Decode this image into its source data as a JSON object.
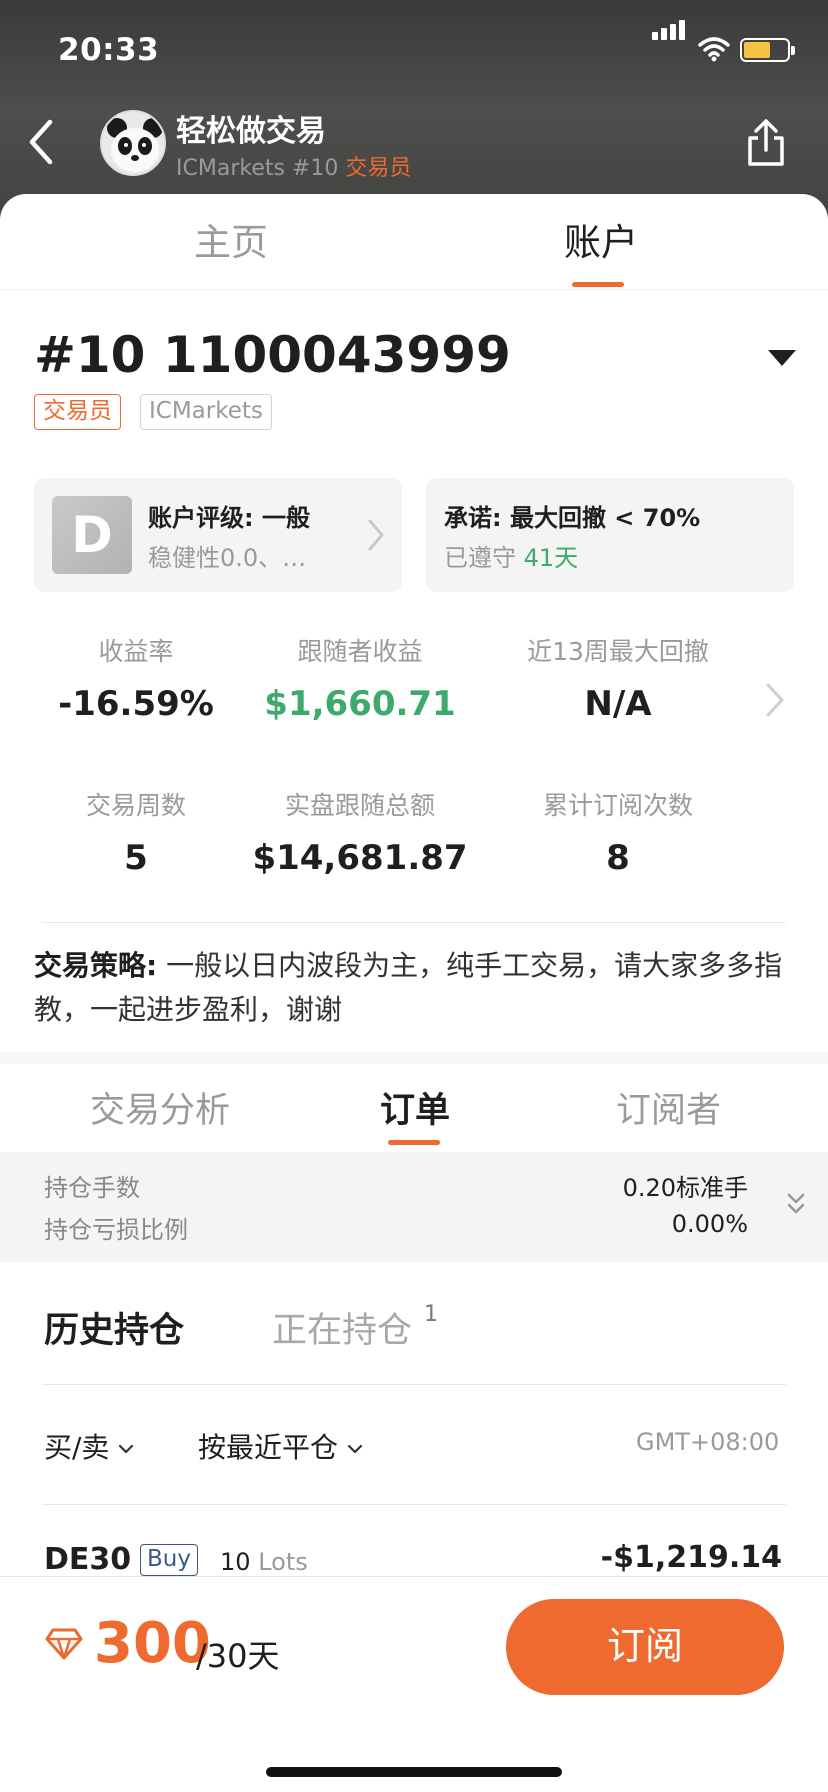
{
  "status_bar": {
    "time": "20:33"
  },
  "header": {
    "title": "轻松做交易",
    "broker_line": "ICMarkets #10",
    "role_tag": "交易员"
  },
  "top_tabs": [
    {
      "label": "主页",
      "active": false
    },
    {
      "label": "账户",
      "active": true
    }
  ],
  "account": {
    "number": "#10 1100043999",
    "tags": [
      "交易员",
      "ICMarkets"
    ]
  },
  "rating_card": {
    "grade": "D",
    "title": "账户评级: 一般",
    "subtitle": "稳健性0.0、…"
  },
  "promise_card": {
    "title": "承诺: 最大回撤 < 70%",
    "subtitle_prefix": "已遵守",
    "subtitle_days": "41天"
  },
  "stats": [
    {
      "label": "收益率",
      "value": "-16.59%"
    },
    {
      "label": "跟随者收益",
      "value": "$1,660.71"
    },
    {
      "label": "近13周最大回撤",
      "value": "N/A"
    },
    {
      "label": "交易周数",
      "value": "5"
    },
    {
      "label": "实盘跟随总额",
      "value": "$14,681.87"
    },
    {
      "label": "累计订阅次数",
      "value": "8"
    }
  ],
  "strategy": {
    "label": "交易策略:",
    "text": " 一般以日内波段为主，纯手工交易，请大家多多指教，一起进步盈利，谢谢"
  },
  "sub_tabs": [
    {
      "label": "交易分析",
      "active": false
    },
    {
      "label": "订单",
      "active": true
    },
    {
      "label": "订阅者",
      "active": false
    }
  ],
  "summary": {
    "lots_label": "持仓手数",
    "lots_value": "0.20标准手",
    "loss_label": "持仓亏损比例",
    "loss_value": "0.00%"
  },
  "position_tabs": {
    "history": "历史持仓",
    "open": "正在持仓",
    "open_count": "1"
  },
  "filters": {
    "side": "买/卖",
    "sort": "按最近平仓",
    "timezone": "GMT+08:00"
  },
  "orders": [
    {
      "symbol": "DE30",
      "side": "Buy",
      "qty": "10",
      "unit": "Lots",
      "pnl": "-$1,219.14"
    }
  ],
  "footer": {
    "price": "300",
    "period": "/30天",
    "subscribe_label": "订阅"
  },
  "colors": {
    "accent": "#ee6a2e",
    "positive": "#3daa6c",
    "buy": "#3a5a8a"
  }
}
